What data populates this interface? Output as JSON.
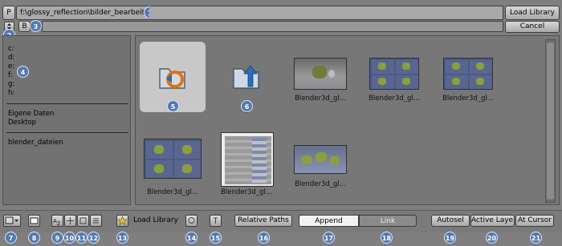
{
  "header": {
    "p_button": "P",
    "path": "f:\\glossy_reflection\\bilder_bearbeitet\\",
    "load_button": "Load Library",
    "b_button": "B",
    "cancel_button": "Cancel"
  },
  "sidebar": {
    "drives": [
      "c:",
      "d:",
      "e:",
      "f:",
      "g:",
      "h:"
    ],
    "bookmarks": [
      "Eigene Daten",
      "Desktop"
    ],
    "recent": [
      "blender_dateien"
    ]
  },
  "files": [
    {
      "name": "",
      "kind": "parent-folder"
    },
    {
      "name": "..",
      "kind": "up-folder"
    },
    {
      "name": "Blender3d_gl...",
      "kind": "image"
    },
    {
      "name": "Blender3d_gl...",
      "kind": "image"
    },
    {
      "name": "Blender3d_gl...",
      "kind": "image"
    },
    {
      "name": "Blender3d_gl...",
      "kind": "image"
    },
    {
      "name": "Blender3d_gl...",
      "kind": "screenshot"
    },
    {
      "name": "Blender3d_gl...",
      "kind": "image"
    }
  ],
  "footer": {
    "load_library_label": "Load Library",
    "relative_paths": "Relative Paths",
    "append": "Append",
    "link": "Link",
    "autosel": "Autosel",
    "active_layer": "Active Layer",
    "at_cursor": "At Cursor"
  },
  "markers": [
    "1",
    "2",
    "3",
    "4",
    "5",
    "6",
    "7",
    "8",
    "9",
    "10",
    "11",
    "12",
    "13",
    "14",
    "15",
    "16",
    "17",
    "18",
    "19",
    "20",
    "21"
  ],
  "colors": {
    "background": "#7f7f7f",
    "panel": "#727272",
    "selected": "#c8c8c8",
    "marker": "#5478b4",
    "append_active": "#f2f2f2",
    "link_inactive": "#8a8a8a"
  },
  "icons": [
    "folder-reload-icon",
    "folder-up-icon",
    "updown-arrows-icon",
    "screen-icon",
    "sort-alpha-icon",
    "sort-time-icon",
    "sort-size-icon",
    "sort-extension-icon",
    "star-icon",
    "ghost-icon",
    "filter-icon"
  ]
}
